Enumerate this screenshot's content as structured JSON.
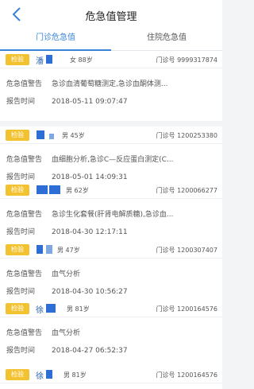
{
  "header": {
    "title": "危急值管理"
  },
  "tabs": [
    {
      "label": "门诊危急值"
    },
    {
      "label": "住院危急值"
    }
  ],
  "labels": {
    "warning": "危急值警告",
    "report_time": "报告时间",
    "badge": "检验"
  },
  "cards": [
    {
      "name": "潘",
      "gender_age": "女 88岁",
      "visit_no": "门诊号 9999317874",
      "warning": "急诊血清葡萄糖测定,急诊血酮体测...",
      "time": "2018-05-11 09:07:47"
    },
    {
      "name": "",
      "gender_age": "男 45岁",
      "visit_no": "门诊号 1200253380",
      "warning": "血细胞分析,急诊C—反应蛋白测定(C...",
      "time": "2018-05-01 14:09:31"
    },
    {
      "name": "",
      "gender_age": "男 62岁",
      "visit_no": "门诊号 1200066277",
      "warning": "急诊生化套餐(肝肾电解质糖),急诊血...",
      "time": "2018-04-30 12:17:11"
    },
    {
      "name": "",
      "gender_age": "男 47岁",
      "visit_no": "门诊号 1200307407",
      "warning": "血气分析",
      "time": "2018-04-30 10:56:27"
    },
    {
      "name": "徐",
      "gender_age": "男 81岁",
      "visit_no": "门诊号 1200164576",
      "warning": "血气分析",
      "time": "2018-04-27 06:52:37"
    },
    {
      "name": "徐",
      "gender_age": "男 81岁",
      "visit_no": "门诊号 1200164576",
      "warning": "",
      "time": ""
    }
  ]
}
